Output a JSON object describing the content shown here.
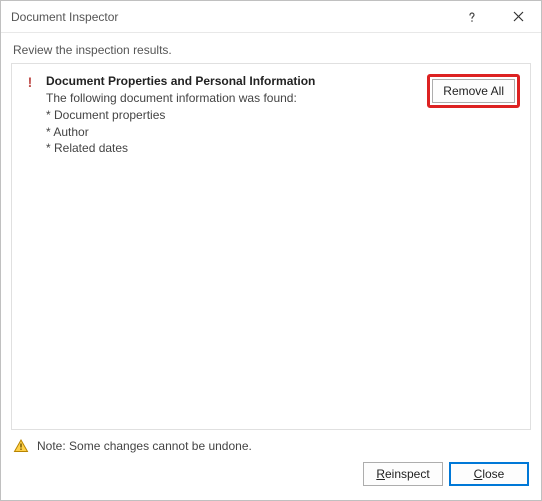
{
  "titlebar": {
    "title": "Document Inspector"
  },
  "subtitle": "Review the inspection results.",
  "result": {
    "icon": "!",
    "title": "Document Properties and Personal Information",
    "desc": "The following document information was found:",
    "items": [
      "* Document properties",
      "* Author",
      "* Related dates"
    ],
    "remove_label": "Remove All"
  },
  "footer": {
    "note": "Note: Some changes cannot be undone.",
    "reinspect_label": "Reinspect",
    "close_label_pre": "",
    "close_label_u": "C",
    "close_label_post": "lose"
  }
}
